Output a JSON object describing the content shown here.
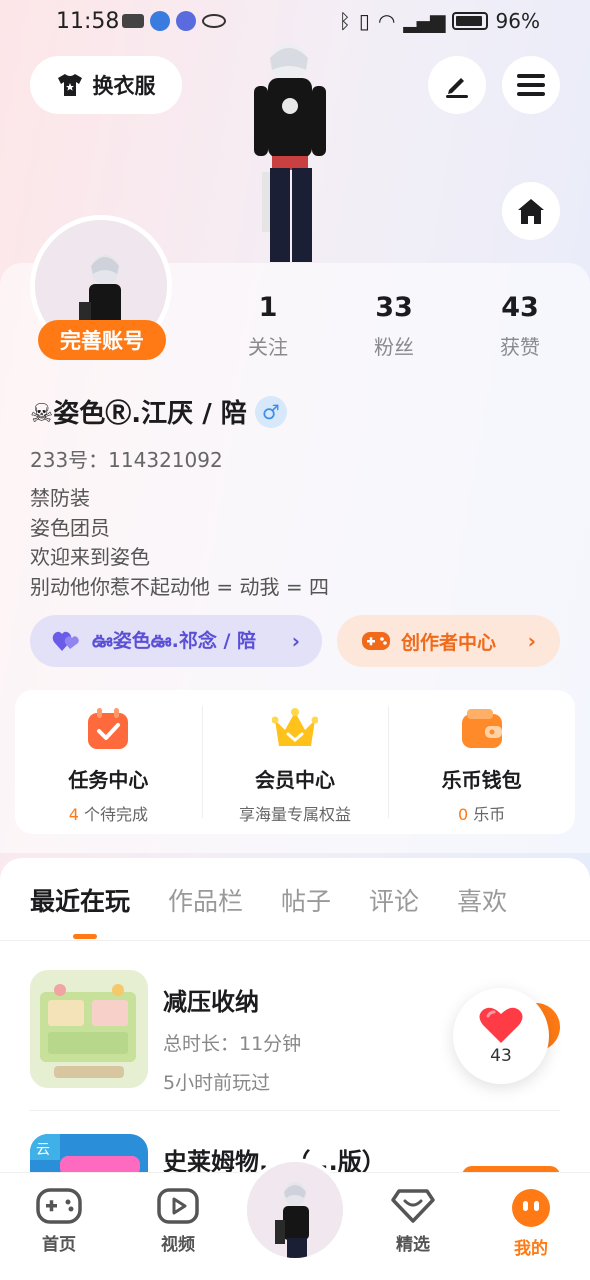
{
  "status_bar": {
    "time": "11:58",
    "battery": "96%"
  },
  "header": {
    "outfit_label": "换衣服"
  },
  "profile": {
    "complete_badge": "完善账号",
    "nickname": "☠姿色Ⓡ.江厌 / 陪",
    "gender": "♂",
    "uid": "233号：114321092",
    "bio": [
      "禁防装",
      "姿色团员",
      "欢迎来到姿色",
      "别动他你惹不起动他 = 动我 = 四"
    ],
    "stats": [
      {
        "value": "1",
        "label": "关注"
      },
      {
        "value": "33",
        "label": "粉丝"
      },
      {
        "value": "43",
        "label": "获赞"
      }
    ],
    "guild_label": "ఊ姿色ఊ.祁念 / 陪",
    "creator_label": "创作者中心"
  },
  "features": [
    {
      "title": "任务中心",
      "sub_count": "4",
      "sub_text": " 个待完成"
    },
    {
      "title": "会员中心",
      "sub_count": "",
      "sub_text": "享海量专属权益"
    },
    {
      "title": "乐币钱包",
      "sub_count": "0",
      "sub_text": " 乐币"
    }
  ],
  "tabs": [
    "最近在玩",
    "作品栏",
    "帖子",
    "评论",
    "喜欢"
  ],
  "games": [
    {
      "title": "减压收纳",
      "duration": "总时长：11分钟",
      "last_played": "5小时前玩过"
    },
    {
      "title": "史莱姆物...（...版）"
    }
  ],
  "like_count": "43",
  "nav": [
    "首页",
    "视频",
    "精选",
    "我的"
  ],
  "colors": {
    "accent": "#ff7a14",
    "guild": "#5b4fd6"
  }
}
